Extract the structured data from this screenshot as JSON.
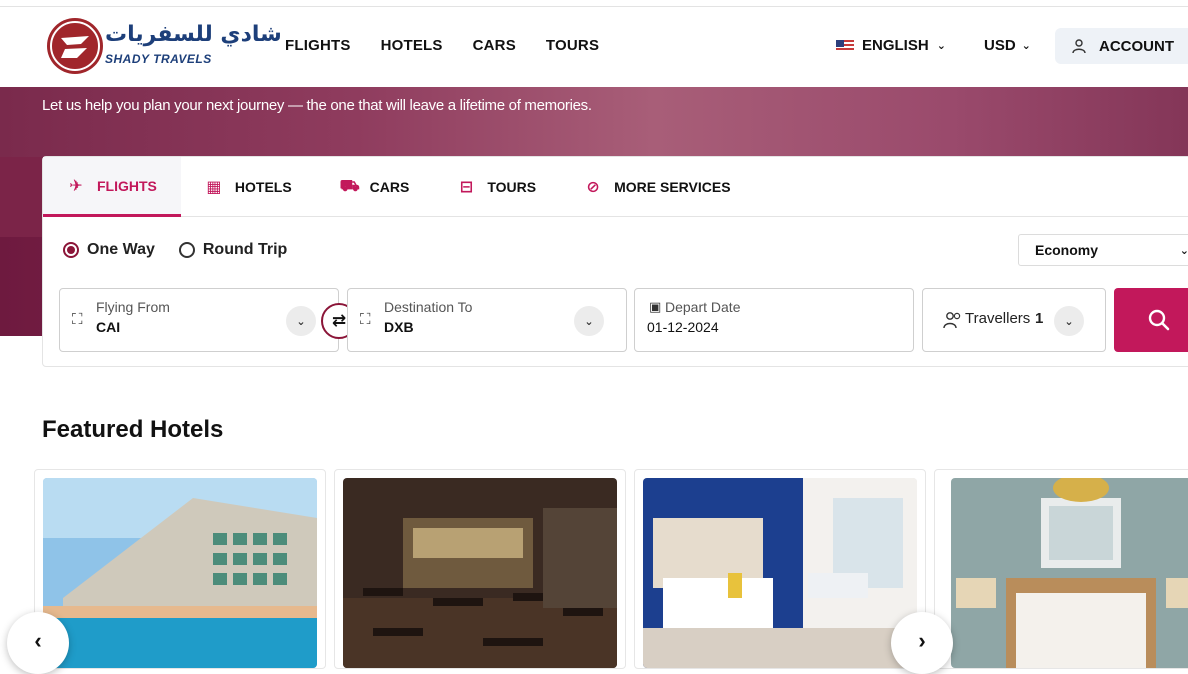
{
  "brand": {
    "name_arabic": "شادي للسفريات",
    "name_latin": "SHADY TRAVELS"
  },
  "nav": {
    "items": [
      "FLIGHTS",
      "HOTELS",
      "CARS",
      "TOURS"
    ]
  },
  "header": {
    "language": "ENGLISH",
    "currency": "USD",
    "account": "ACCOUNT"
  },
  "hero": {
    "tagline": "Let us help you plan your next journey — the one that will leave a lifetime of memories."
  },
  "search": {
    "tabs": [
      "FLIGHTS",
      "HOTELS",
      "CARS",
      "TOURS",
      "MORE SERVICES"
    ],
    "active_tab": "FLIGHTS",
    "trip_types": [
      "One Way",
      "Round Trip"
    ],
    "selected_trip": "One Way",
    "cabin_class": "Economy",
    "from": {
      "label": "Flying From",
      "value": "CAI"
    },
    "to": {
      "label": "Destination To",
      "value": "DXB"
    },
    "depart": {
      "label": "Depart Date",
      "value": "01-12-2024"
    },
    "travellers": {
      "label": "Travellers",
      "count": "1"
    }
  },
  "featured": {
    "title": "Featured Hotels"
  },
  "icons": {
    "tab_icons": [
      "plane-icon",
      "building-icon",
      "car-icon",
      "bus-icon",
      "compass-icon"
    ],
    "accent_color": "#c2185b"
  }
}
